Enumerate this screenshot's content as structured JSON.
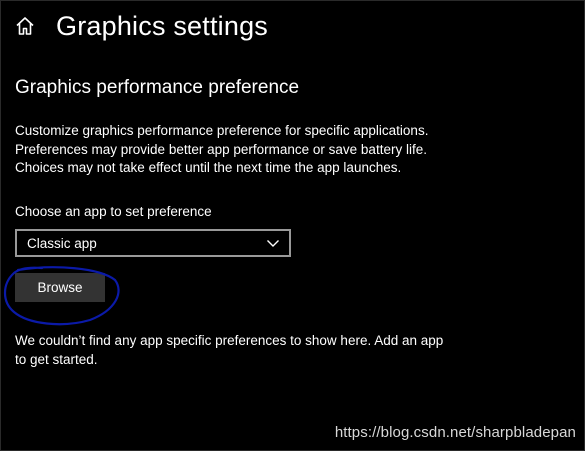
{
  "header": {
    "title": "Graphics settings",
    "home_icon": "home-icon"
  },
  "section": {
    "title": "Graphics performance preference",
    "description_lines": [
      "Customize graphics performance preference for specific applications.",
      "Preferences may provide better app performance or save battery life.",
      "Choices may not take effect until the next time the app launches."
    ]
  },
  "app_picker": {
    "label": "Choose an app to set preference",
    "selected_value": "Classic app",
    "chevron_icon": "chevron-down-icon"
  },
  "browse_button": {
    "label": "Browse"
  },
  "empty_state": {
    "lines": [
      "We couldn’t find any app specific preferences to show here. Add an app",
      "to get started."
    ]
  },
  "annotation": {
    "color": "#0b1aa8"
  },
  "watermark": {
    "text": "https://blog.csdn.net/sharpbladepan"
  },
  "colors": {
    "background": "#000000",
    "text": "#ffffff",
    "button_bg": "#333333",
    "select_border": "#999999"
  }
}
